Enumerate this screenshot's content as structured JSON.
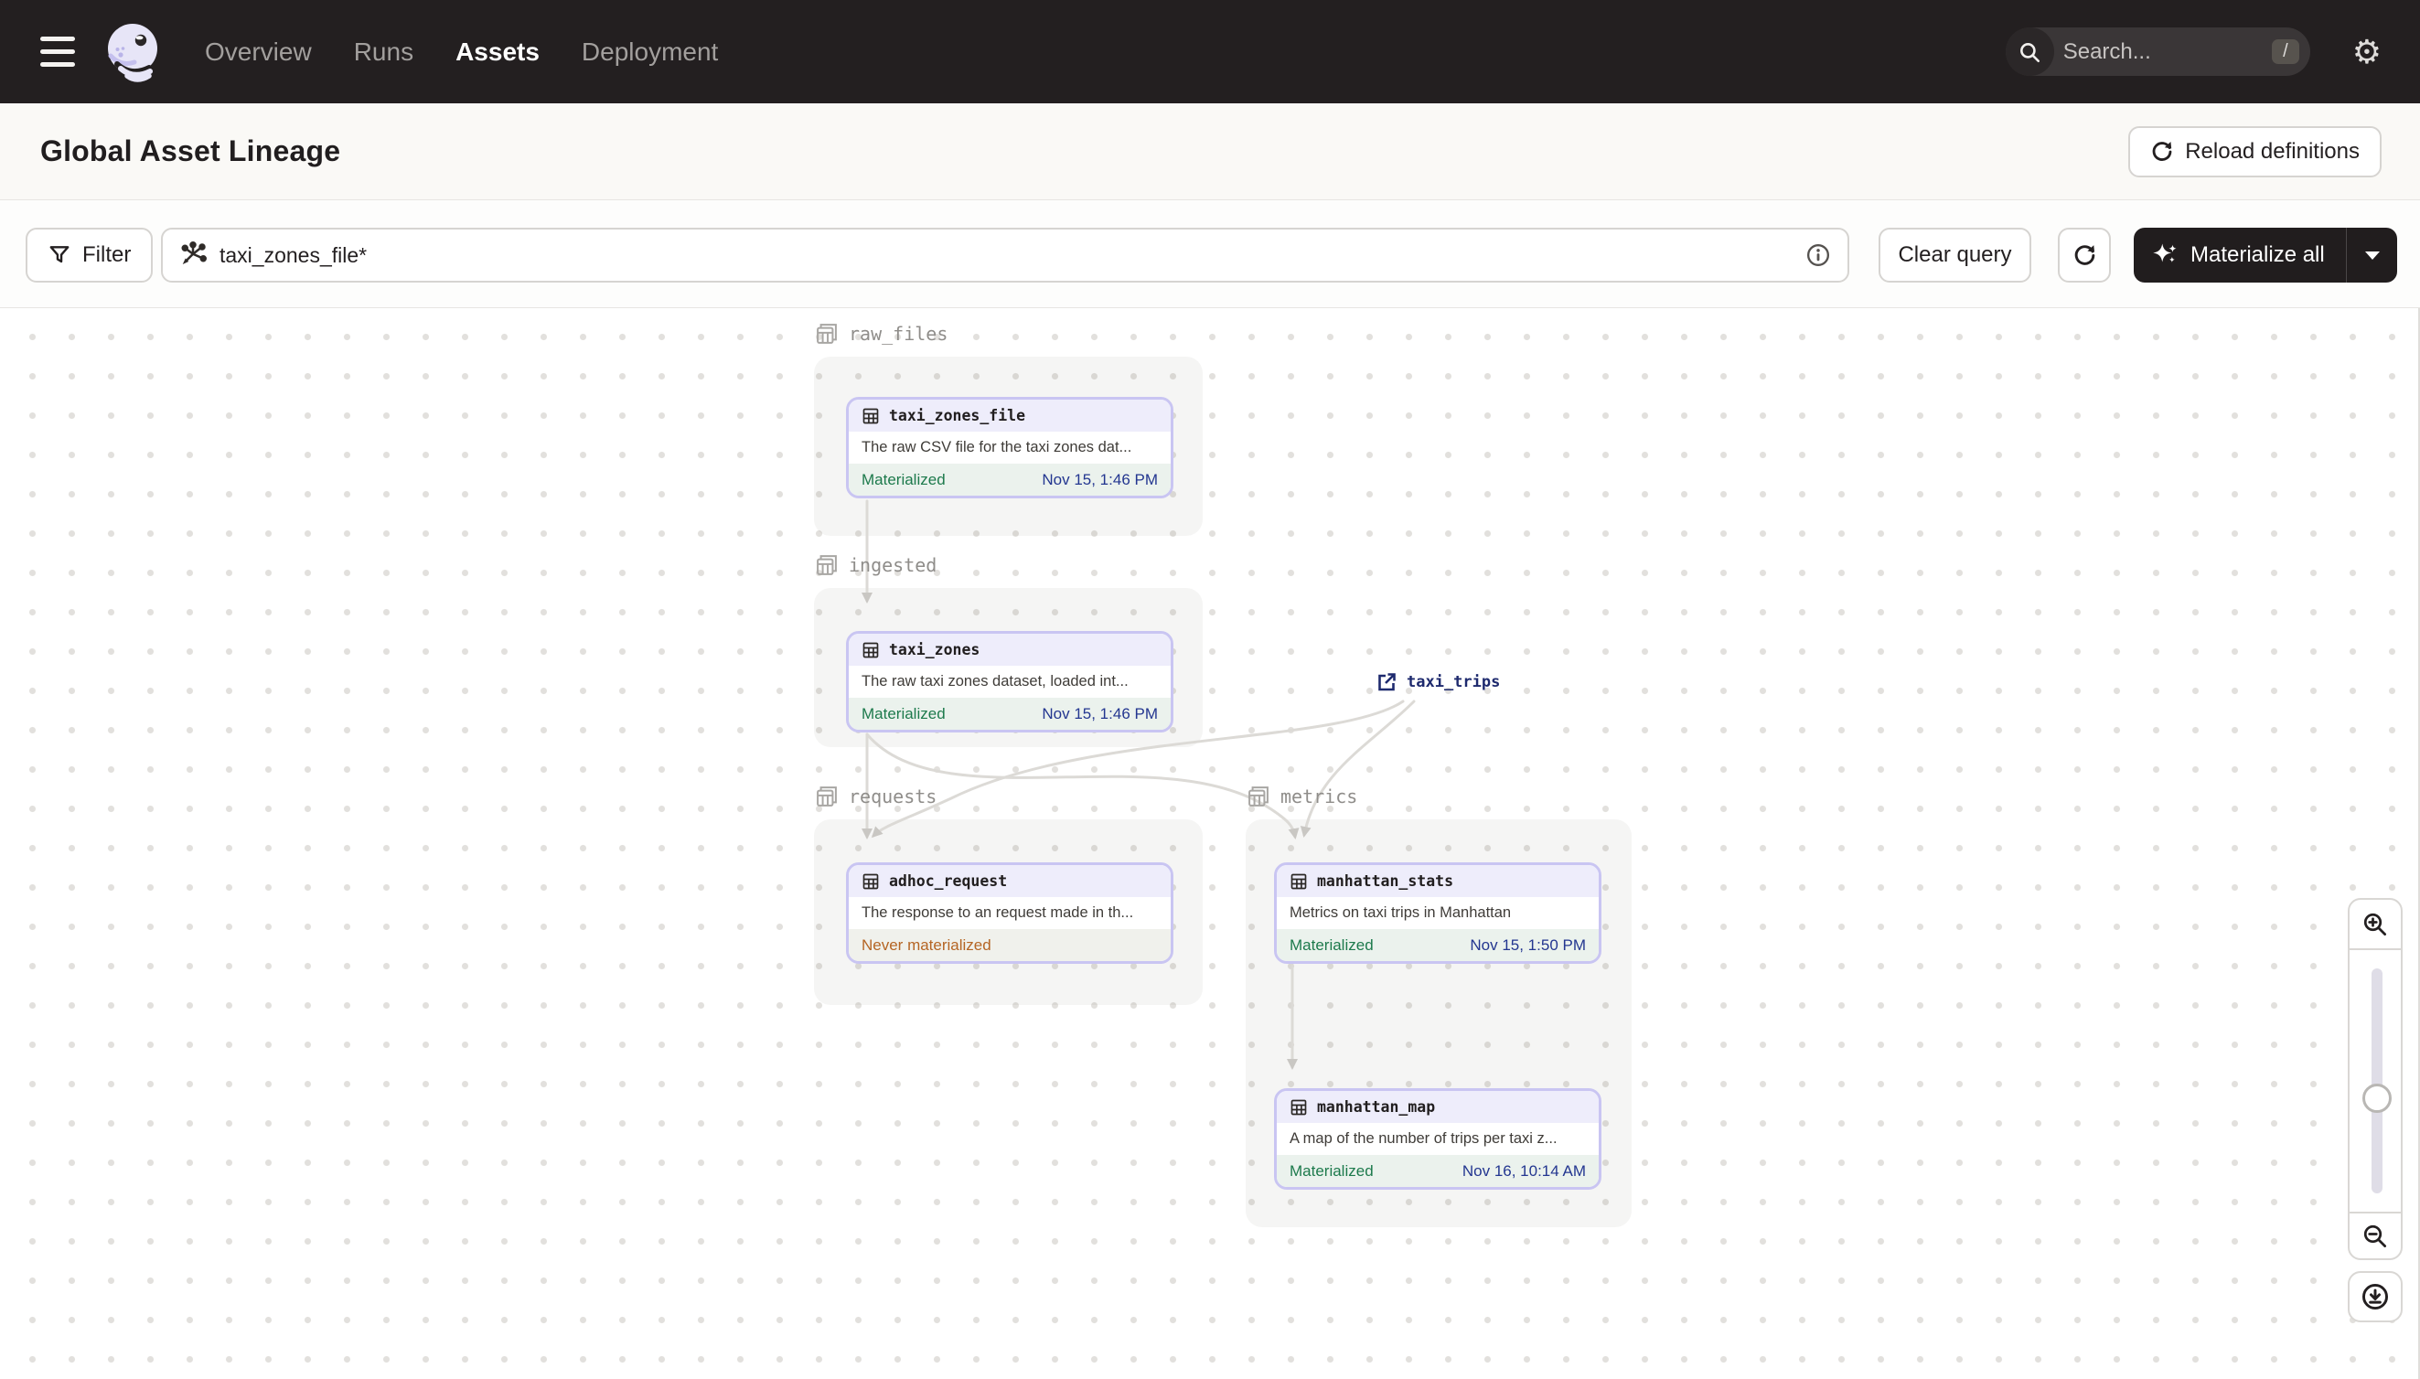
{
  "nav": {
    "tabs": [
      {
        "label": "Overview",
        "active": false
      },
      {
        "label": "Runs",
        "active": false
      },
      {
        "label": "Assets",
        "active": true
      },
      {
        "label": "Deployment",
        "active": false
      }
    ],
    "search": {
      "placeholder": "Search...",
      "shortcut": "/"
    }
  },
  "header": {
    "title": "Global Asset Lineage",
    "reload_button_label": "Reload definitions"
  },
  "toolbar": {
    "filter_label": "Filter",
    "query_value": "taxi_zones_file*",
    "clear_query_label": "Clear query",
    "materialize_label": "Materialize all"
  },
  "graph": {
    "groups": {
      "raw_files": "raw_files",
      "ingested": "ingested",
      "requests": "requests",
      "metrics": "metrics"
    },
    "external": {
      "name": "taxi_trips"
    },
    "nodes": [
      {
        "name": "taxi_zones_file",
        "description": "The raw CSV file for the taxi zones dat...",
        "status": "Materialized",
        "timestamp": "Nov 15, 1:46 PM"
      },
      {
        "name": "taxi_zones",
        "description": "The raw taxi zones dataset, loaded int...",
        "status": "Materialized",
        "timestamp": "Nov 15, 1:46 PM"
      },
      {
        "name": "adhoc_request",
        "description": "The response to an request made in th...",
        "status": "Never materialized",
        "timestamp": ""
      },
      {
        "name": "manhattan_stats",
        "description": "Metrics on taxi trips in Manhattan",
        "status": "Materialized",
        "timestamp": "Nov 15, 1:50 PM"
      },
      {
        "name": "manhattan_map",
        "description": "A map of the number of trips per taxi z...",
        "status": "Materialized",
        "timestamp": "Nov 16, 10:14 AM"
      }
    ]
  },
  "icons": {
    "node_icon": "table-grid",
    "group_icon": "layered-tables",
    "external_icon": "external-link"
  },
  "colors": {
    "nav_bg": "#231F20",
    "node_border": "#C9C5F2",
    "node_header_bg": "#EEEDFB",
    "materialized_green": "#1D7A4C",
    "never_materialized_amber": "#B56524",
    "timestamp_navy": "#233690",
    "external_navy": "#1E2A6E",
    "edge_gray": "#DCDAD6"
  }
}
